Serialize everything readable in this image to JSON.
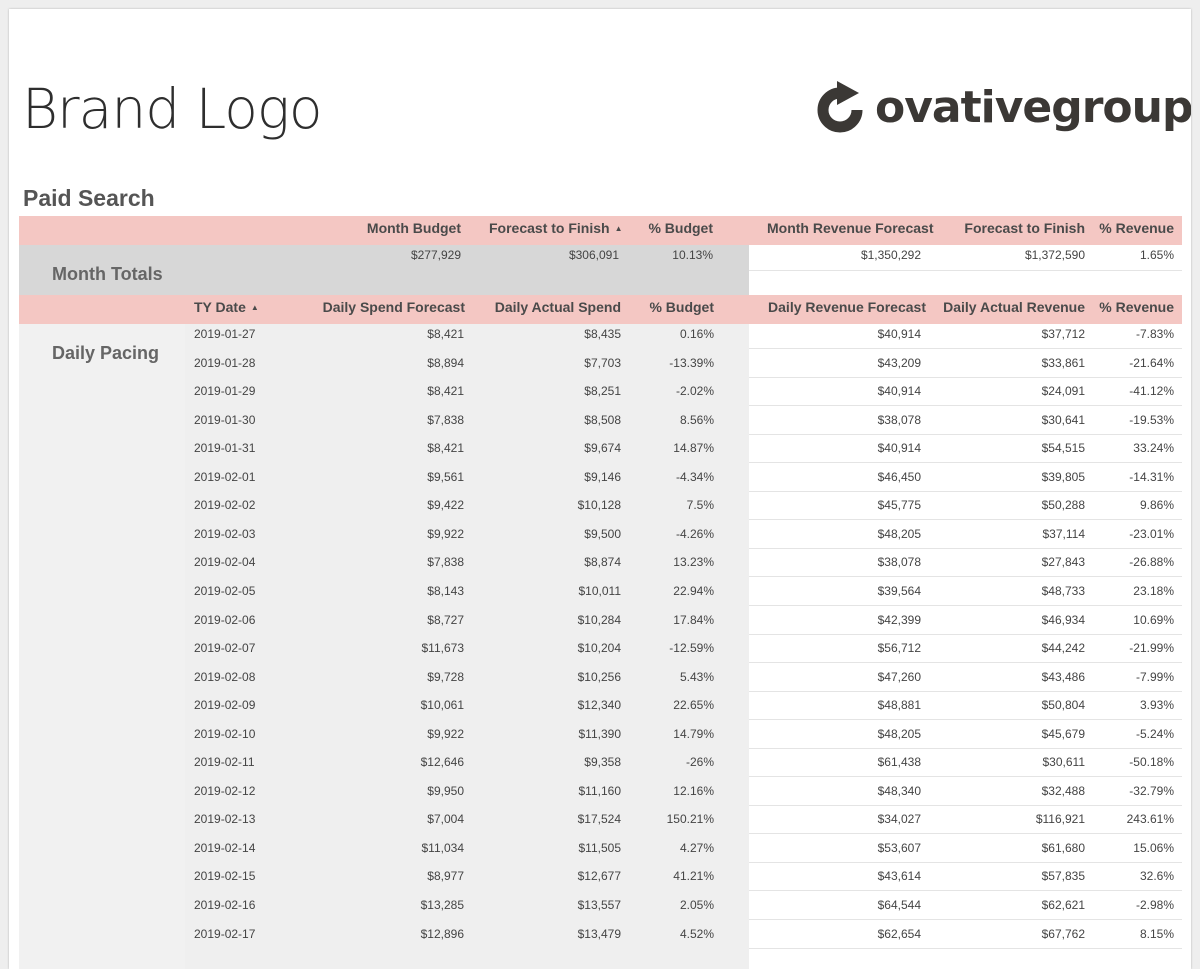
{
  "header": {
    "brand_logo": "Brand Logo",
    "partner_logo": "ovativegroup"
  },
  "section_title": "Paid Search",
  "totals": {
    "label": "Month Totals",
    "headers": [
      "Month Budget",
      "Forecast to Finish",
      "% Budget",
      "Month Revenue Forecast",
      "Forecast to Finish",
      "% Revenue"
    ],
    "values": [
      "$277,929",
      "$306,091",
      "10.13%",
      "$1,350,292",
      "$1,372,590",
      "1.65%"
    ]
  },
  "daily": {
    "label": "Daily Pacing",
    "headers": [
      "TY Date",
      "Daily Spend Forecast",
      "Daily Actual Spend",
      "% Budget",
      "Daily Revenue Forecast",
      "Daily Actual Revenue",
      "% Revenue"
    ],
    "rows": [
      [
        "2019-01-27",
        "$8,421",
        "$8,435",
        "0.16%",
        "$40,914",
        "$37,712",
        "-7.83%"
      ],
      [
        "2019-01-28",
        "$8,894",
        "$7,703",
        "-13.39%",
        "$43,209",
        "$33,861",
        "-21.64%"
      ],
      [
        "2019-01-29",
        "$8,421",
        "$8,251",
        "-2.02%",
        "$40,914",
        "$24,091",
        "-41.12%"
      ],
      [
        "2019-01-30",
        "$7,838",
        "$8,508",
        "8.56%",
        "$38,078",
        "$30,641",
        "-19.53%"
      ],
      [
        "2019-01-31",
        "$8,421",
        "$9,674",
        "14.87%",
        "$40,914",
        "$54,515",
        "33.24%"
      ],
      [
        "2019-02-01",
        "$9,561",
        "$9,146",
        "-4.34%",
        "$46,450",
        "$39,805",
        "-14.31%"
      ],
      [
        "2019-02-02",
        "$9,422",
        "$10,128",
        "7.5%",
        "$45,775",
        "$50,288",
        "9.86%"
      ],
      [
        "2019-02-03",
        "$9,922",
        "$9,500",
        "-4.26%",
        "$48,205",
        "$37,114",
        "-23.01%"
      ],
      [
        "2019-02-04",
        "$7,838",
        "$8,874",
        "13.23%",
        "$38,078",
        "$27,843",
        "-26.88%"
      ],
      [
        "2019-02-05",
        "$8,143",
        "$10,011",
        "22.94%",
        "$39,564",
        "$48,733",
        "23.18%"
      ],
      [
        "2019-02-06",
        "$8,727",
        "$10,284",
        "17.84%",
        "$42,399",
        "$46,934",
        "10.69%"
      ],
      [
        "2019-02-07",
        "$11,673",
        "$10,204",
        "-12.59%",
        "$56,712",
        "$44,242",
        "-21.99%"
      ],
      [
        "2019-02-08",
        "$9,728",
        "$10,256",
        "5.43%",
        "$47,260",
        "$43,486",
        "-7.99%"
      ],
      [
        "2019-02-09",
        "$10,061",
        "$12,340",
        "22.65%",
        "$48,881",
        "$50,804",
        "3.93%"
      ],
      [
        "2019-02-10",
        "$9,922",
        "$11,390",
        "14.79%",
        "$48,205",
        "$45,679",
        "-5.24%"
      ],
      [
        "2019-02-11",
        "$12,646",
        "$9,358",
        "-26%",
        "$61,438",
        "$30,611",
        "-50.18%"
      ],
      [
        "2019-02-12",
        "$9,950",
        "$11,160",
        "12.16%",
        "$48,340",
        "$32,488",
        "-32.79%"
      ],
      [
        "2019-02-13",
        "$7,004",
        "$17,524",
        "150.21%",
        "$34,027",
        "$116,921",
        "243.61%"
      ],
      [
        "2019-02-14",
        "$11,034",
        "$11,505",
        "4.27%",
        "$53,607",
        "$61,680",
        "15.06%"
      ],
      [
        "2019-02-15",
        "$8,977",
        "$12,677",
        "41.21%",
        "$43,614",
        "$57,835",
        "32.6%"
      ],
      [
        "2019-02-16",
        "$13,285",
        "$13,557",
        "2.05%",
        "$64,544",
        "$62,621",
        "-2.98%"
      ],
      [
        "2019-02-17",
        "$12,896",
        "$13,479",
        "4.52%",
        "$62,654",
        "$67,762",
        "8.15%"
      ]
    ]
  },
  "colors": {
    "header_band": "#f4c7c3",
    "totals_label_bg": "#d7d7d7",
    "daily_bg": "#efefef"
  },
  "icons": {
    "sort": "sort-ascending-icon",
    "partner_mark": "refresh-arrow-icon"
  }
}
